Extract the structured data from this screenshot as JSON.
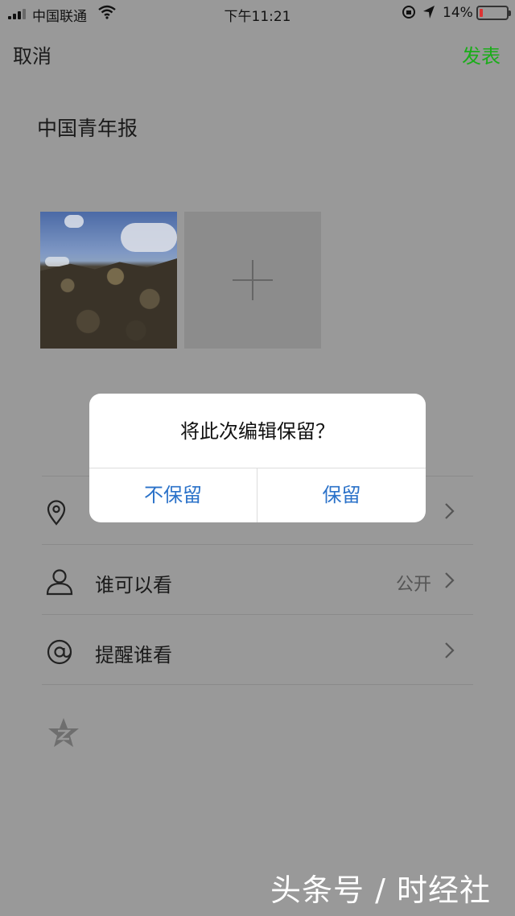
{
  "status_bar": {
    "carrier": "中国联通",
    "time": "下午11:21",
    "battery_percent": "14%",
    "battery_level": 0.14,
    "battery_color": "#dd3333"
  },
  "nav": {
    "cancel_label": "取消",
    "publish_label": "发表",
    "publish_color": "#1aad19"
  },
  "post": {
    "text": "中国青年报"
  },
  "photos": {
    "add_icon": "plus-icon"
  },
  "list": [
    {
      "icon": "location-pin-icon",
      "label": "",
      "value": ""
    },
    {
      "icon": "person-icon",
      "label": "谁可以看",
      "value": "公开"
    },
    {
      "icon": "at-icon",
      "label": "提醒谁看",
      "value": ""
    }
  ],
  "qzone_icon": "qzone-star-icon",
  "dialog": {
    "title": "将此次编辑保留？",
    "discard_label": "不保留",
    "keep_label": "保留",
    "button_color": "#2b72c9"
  },
  "watermark": "头条号 / 时经社"
}
